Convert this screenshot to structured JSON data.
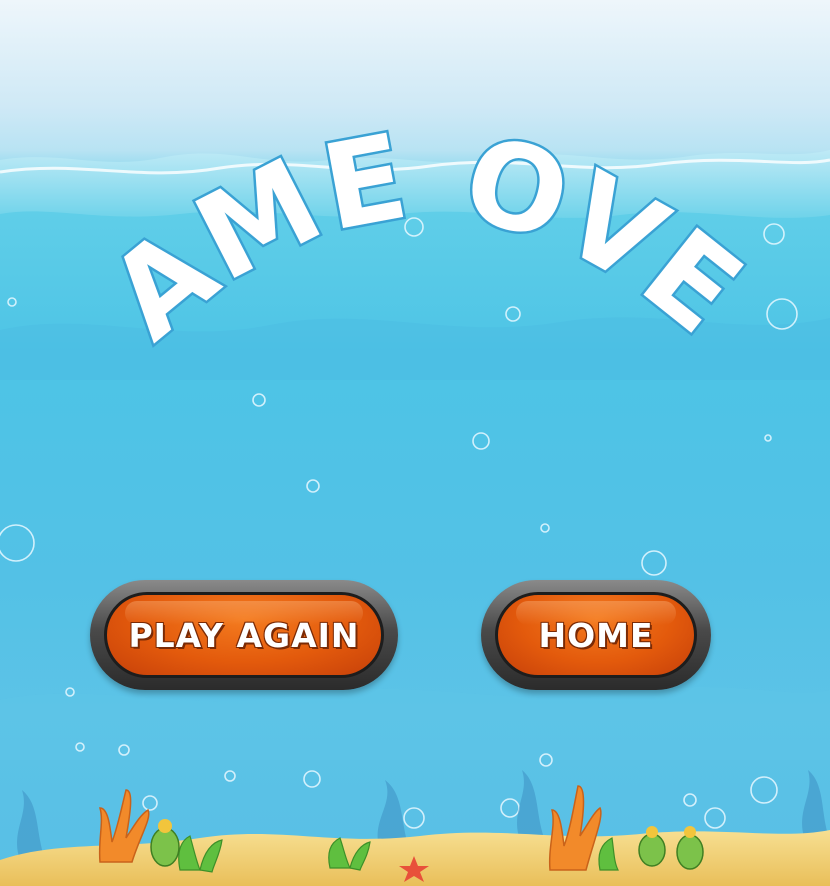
{
  "title": "GAME OVER",
  "buttons": {
    "play_again": "PLAY AGAIN",
    "home": "HOME"
  },
  "colors": {
    "button_face": "#e35a0c",
    "button_rim": "#3a3a3a",
    "title_fill": "#ffffff",
    "title_stroke": "#3aa2d4",
    "water": "#53c1e6",
    "sand": "#f2d27a"
  }
}
